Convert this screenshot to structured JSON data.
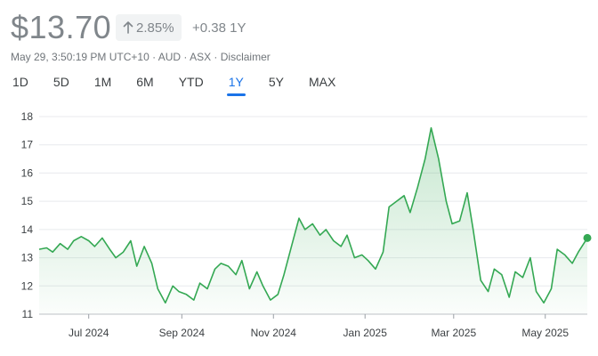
{
  "quote": {
    "price": "$13.70",
    "change_pct": "2.85%",
    "change_abs": "+0.38 1Y",
    "meta": "May 29, 3:50:19 PM UTC+10 · AUD · ASX · Disclaimer"
  },
  "ranges": [
    {
      "label": "1D",
      "active": false
    },
    {
      "label": "5D",
      "active": false
    },
    {
      "label": "1M",
      "active": false
    },
    {
      "label": "6M",
      "active": false
    },
    {
      "label": "YTD",
      "active": false
    },
    {
      "label": "1Y",
      "active": true
    },
    {
      "label": "5Y",
      "active": false
    },
    {
      "label": "MAX",
      "active": false
    }
  ],
  "colors": {
    "line": "#34a853",
    "fill": "#34a853",
    "gridline": "#e8eaed",
    "accent": "#1a73e8"
  },
  "chart_data": {
    "type": "area",
    "ylim": [
      11,
      18
    ],
    "y_ticks": [
      11,
      12,
      13,
      14,
      15,
      16,
      17,
      18
    ],
    "x_ticks": [
      "Jul 2024",
      "Sep 2024",
      "Nov 2024",
      "Jan 2025",
      "Mar 2025",
      "May 2025"
    ],
    "x_tick_dates": [
      "2024-07-01",
      "2024-09-01",
      "2024-11-01",
      "2025-01-01",
      "2025-03-01",
      "2025-05-01"
    ],
    "xlim": [
      "2024-05-29",
      "2025-05-29"
    ],
    "grid": true,
    "series": [
      {
        "x": [
          "2024-05-29",
          "2024-06-03",
          "2024-06-07",
          "2024-06-12",
          "2024-06-17",
          "2024-06-21",
          "2024-06-26",
          "2024-07-01",
          "2024-07-05",
          "2024-07-10",
          "2024-07-15",
          "2024-07-19",
          "2024-07-24",
          "2024-07-29",
          "2024-08-02",
          "2024-08-07",
          "2024-08-12",
          "2024-08-16",
          "2024-08-21",
          "2024-08-26",
          "2024-08-30",
          "2024-09-04",
          "2024-09-09",
          "2024-09-13",
          "2024-09-18",
          "2024-09-23",
          "2024-09-27",
          "2024-10-02",
          "2024-10-07",
          "2024-10-11",
          "2024-10-16",
          "2024-10-21",
          "2024-10-25",
          "2024-10-30",
          "2024-11-04",
          "2024-11-08",
          "2024-11-13",
          "2024-11-18",
          "2024-11-22",
          "2024-11-27",
          "2024-12-02",
          "2024-12-06",
          "2024-12-11",
          "2024-12-16",
          "2024-12-20",
          "2024-12-25",
          "2024-12-30",
          "2025-01-03",
          "2025-01-08",
          "2025-01-13",
          "2025-01-17",
          "2025-01-22",
          "2025-01-27",
          "2025-01-31",
          "2025-02-05",
          "2025-02-10",
          "2025-02-14",
          "2025-02-19",
          "2025-02-24",
          "2025-02-28",
          "2025-03-05",
          "2025-03-10",
          "2025-03-14",
          "2025-03-19",
          "2025-03-24",
          "2025-03-28",
          "2025-04-02",
          "2025-04-07",
          "2025-04-11",
          "2025-04-16",
          "2025-04-21",
          "2025-04-25",
          "2025-04-30",
          "2025-05-05",
          "2025-05-09",
          "2025-05-14",
          "2025-05-19",
          "2025-05-23",
          "2025-05-29"
        ],
        "values": [
          13.3,
          13.35,
          13.2,
          13.5,
          13.3,
          13.6,
          13.75,
          13.6,
          13.4,
          13.7,
          13.3,
          13.0,
          13.2,
          13.6,
          12.7,
          13.4,
          12.8,
          11.9,
          11.4,
          12.0,
          11.8,
          11.7,
          11.5,
          12.1,
          11.9,
          12.6,
          12.8,
          12.7,
          12.4,
          12.9,
          11.9,
          12.5,
          12.0,
          11.5,
          11.7,
          12.4,
          13.4,
          14.4,
          14.0,
          14.2,
          13.8,
          14.0,
          13.6,
          13.4,
          13.8,
          13.0,
          13.1,
          12.9,
          12.6,
          13.2,
          14.8,
          15.0,
          15.2,
          14.6,
          15.5,
          16.5,
          17.6,
          16.5,
          15.0,
          14.2,
          14.3,
          15.3,
          14.0,
          12.2,
          11.8,
          12.6,
          12.4,
          11.6,
          12.5,
          12.3,
          13.0,
          11.8,
          11.4,
          11.9,
          13.3,
          13.1,
          12.8,
          13.2,
          13.7
        ]
      }
    ]
  }
}
